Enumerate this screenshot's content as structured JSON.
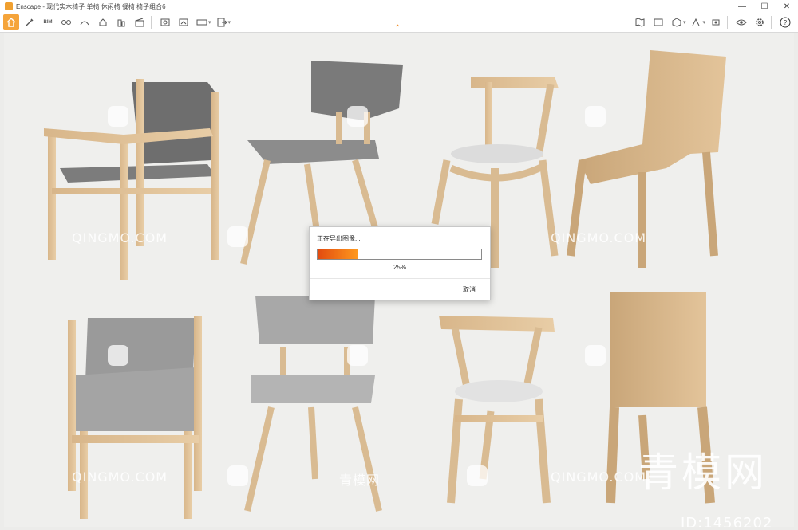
{
  "window": {
    "title": "Enscape - 现代实木椅子 单椅 休闲椅 餐椅 椅子组合6",
    "minimize": "—",
    "maximize": "☐",
    "close": "✕"
  },
  "toolbar": {
    "bim_label": "BIM",
    "left_icons": [
      "home-icon",
      "tools-icon",
      "bim-icon",
      "views-icon",
      "atmosphere-icon",
      "sun-icon",
      "buildings-icon",
      "clapper-icon",
      "screenshot-icon",
      "batch-icon",
      "panorama-icon",
      "export-icon"
    ],
    "right_icons": [
      "map-icon",
      "asset-icon",
      "material-icon",
      "view-settings-icon",
      "capture-icon",
      "eye-icon",
      "gear-icon",
      "help-icon"
    ]
  },
  "dialog": {
    "title": "正在导出图像...",
    "progress_text": "25%",
    "progress": 0.25,
    "cancel_label": "取消"
  },
  "watermark": {
    "text": "QINGMO.COM",
    "cn_text": "青模网",
    "big_text": "青模网",
    "id_text": "ID:1456202"
  },
  "colors": {
    "accent": "#f5a43a",
    "progress_start": "#e24a10",
    "progress_end": "#ff9a1e"
  }
}
